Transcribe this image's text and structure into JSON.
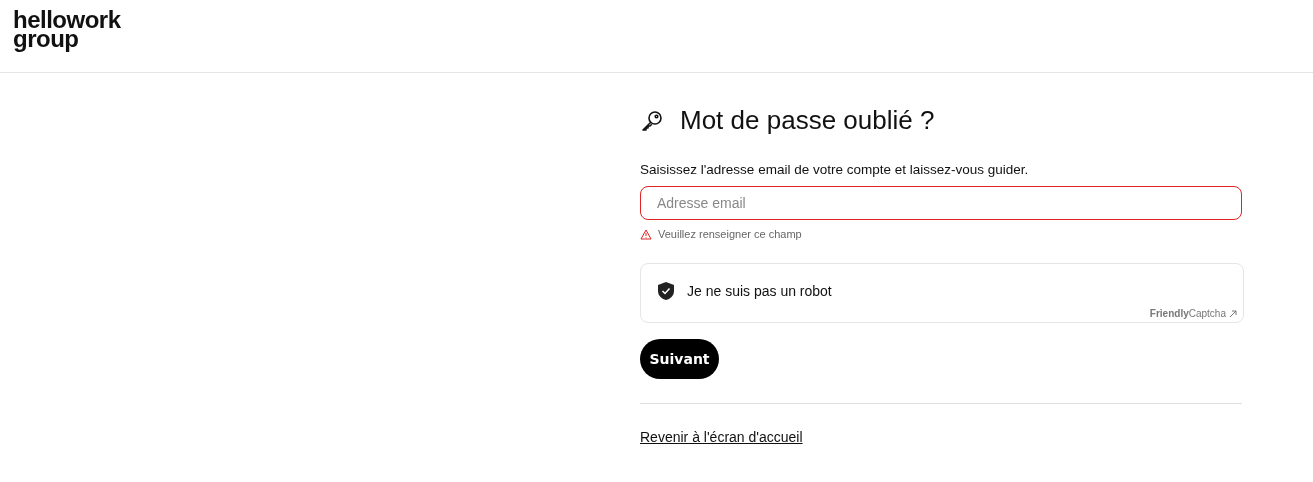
{
  "header": {
    "logo_lines": [
      "hellowork",
      "group"
    ]
  },
  "form": {
    "title": "Mot de passe oublié ?",
    "instruction": "Saisissez l'adresse email de votre compte et laissez-vous guider.",
    "email_field": {
      "placeholder": "Adresse email",
      "invalid": true,
      "error": "Veuillez renseigner ce champ"
    },
    "captcha": {
      "label": "Je ne suis pas un robot",
      "brand": "**Friendly**Captcha"
    },
    "submit": "Suivant",
    "back_link": "Revenir à l'écran d'accueil"
  }
}
